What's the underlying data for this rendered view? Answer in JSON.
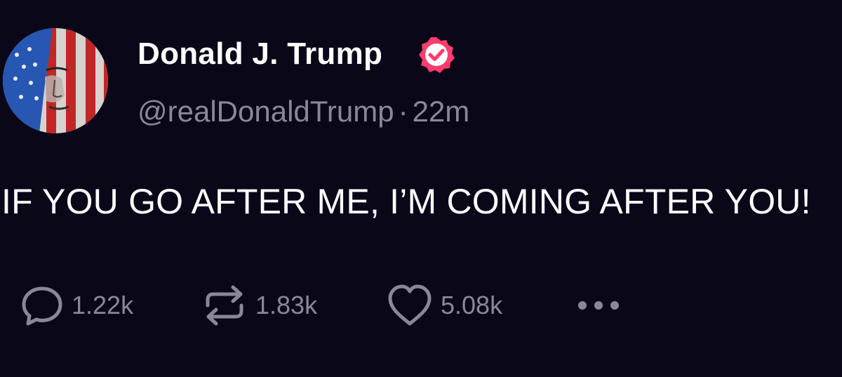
{
  "author": {
    "display_name": "Donald J. Trump",
    "handle": "@realDonaldTrump",
    "separator": "·",
    "timestamp": "22m",
    "badge_color": "#ff3c6e"
  },
  "post": {
    "text": "IF YOU GO AFTER ME, I’M COMING AFTER YOU!"
  },
  "actions": {
    "reply_count": "1.22k",
    "repost_count": "1.83k",
    "like_count": "5.08k",
    "reply_icon": "speech-bubble-icon",
    "repost_icon": "repost-arrows-icon",
    "like_icon": "heart-icon",
    "more_icon": "ellipsis-icon"
  },
  "colors": {
    "background": "#0a0719",
    "primary_text": "#ffffff",
    "secondary_text": "#8a8896"
  }
}
